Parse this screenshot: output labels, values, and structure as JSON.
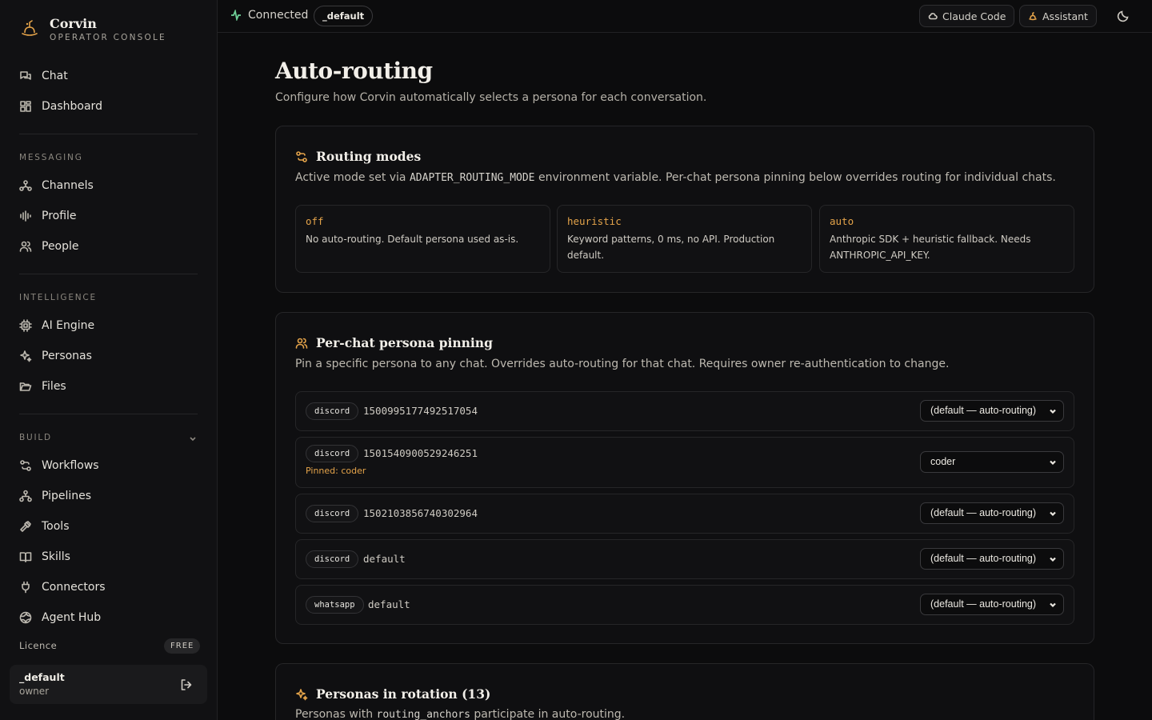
{
  "app": {
    "name": "Corvin",
    "subtitle": "OPERATOR CONSOLE"
  },
  "sidebar": {
    "top_items": [
      {
        "label": "Chat",
        "icon": "chat-icon"
      },
      {
        "label": "Dashboard",
        "icon": "dashboard-icon"
      }
    ],
    "sections": [
      {
        "label": "MESSAGING",
        "items": [
          {
            "label": "Channels",
            "icon": "channels-icon"
          },
          {
            "label": "Profile",
            "icon": "waveform-icon"
          },
          {
            "label": "People",
            "icon": "people-icon"
          }
        ]
      },
      {
        "label": "INTELLIGENCE",
        "items": [
          {
            "label": "AI Engine",
            "icon": "cpu-icon"
          },
          {
            "label": "Personas",
            "icon": "sparkles-icon"
          },
          {
            "label": "Files",
            "icon": "folder-icon"
          }
        ]
      },
      {
        "label": "BUILD",
        "items": [
          {
            "label": "Workflows",
            "icon": "workflow-icon"
          },
          {
            "label": "Pipelines",
            "icon": "pipeline-icon"
          },
          {
            "label": "Tools",
            "icon": "hammer-icon"
          },
          {
            "label": "Skills",
            "icon": "book-icon"
          },
          {
            "label": "Connectors",
            "icon": "plug-icon"
          },
          {
            "label": "Agent Hub",
            "icon": "globe-icon"
          }
        ]
      }
    ],
    "licence_label": "Licence",
    "licence_badge": "FREE",
    "user": {
      "name": "_default",
      "role": "owner"
    }
  },
  "topbar": {
    "status": "Connected",
    "workspace": "_default",
    "claude_code_label": "Claude Code",
    "assistant_label": "Assistant"
  },
  "page": {
    "title": "Auto-routing",
    "subtitle": "Configure how Corvin automatically selects a persona for each conversation."
  },
  "routing_modes": {
    "title": "Routing modes",
    "desc_before": "Active mode set via ",
    "desc_code": "ADAPTER_ROUTING_MODE",
    "desc_after": " environment variable. Per-chat persona pinning below overrides routing for individual chats.",
    "modes": [
      {
        "name": "off",
        "description": "No auto-routing. Default persona used as-is."
      },
      {
        "name": "heuristic",
        "description": "Keyword patterns, 0 ms, no API. Production default."
      },
      {
        "name": "auto",
        "description": "Anthropic SDK + heuristic fallback. Needs ANTHROPIC_API_KEY."
      }
    ]
  },
  "pinning": {
    "title": "Per-chat persona pinning",
    "description": "Pin a specific persona to any chat. Overrides auto-routing for that chat. Requires owner re-authentication to change.",
    "rows": [
      {
        "platform": "discord",
        "chat_id": "1500995177492517054",
        "pinned": "",
        "persona": "(default — auto-routing)"
      },
      {
        "platform": "discord",
        "chat_id": "1501540900529246251",
        "pinned": "Pinned: coder",
        "persona": "coder"
      },
      {
        "platform": "discord",
        "chat_id": "1502103856740302964",
        "pinned": "",
        "persona": "(default — auto-routing)"
      },
      {
        "platform": "discord",
        "chat_id": "default",
        "pinned": "",
        "persona": "(default — auto-routing)"
      },
      {
        "platform": "whatsapp",
        "chat_id": "default",
        "pinned": "",
        "persona": "(default — auto-routing)"
      }
    ]
  },
  "rotation": {
    "title": "Personas in rotation (13)",
    "desc_before": "Personas with ",
    "desc_code": "routing_anchors",
    "desc_after": " participate in auto-routing."
  },
  "colors": {
    "accent": "#e5a44a",
    "connected": "#6fcf97",
    "background": "#0c0c0d"
  }
}
